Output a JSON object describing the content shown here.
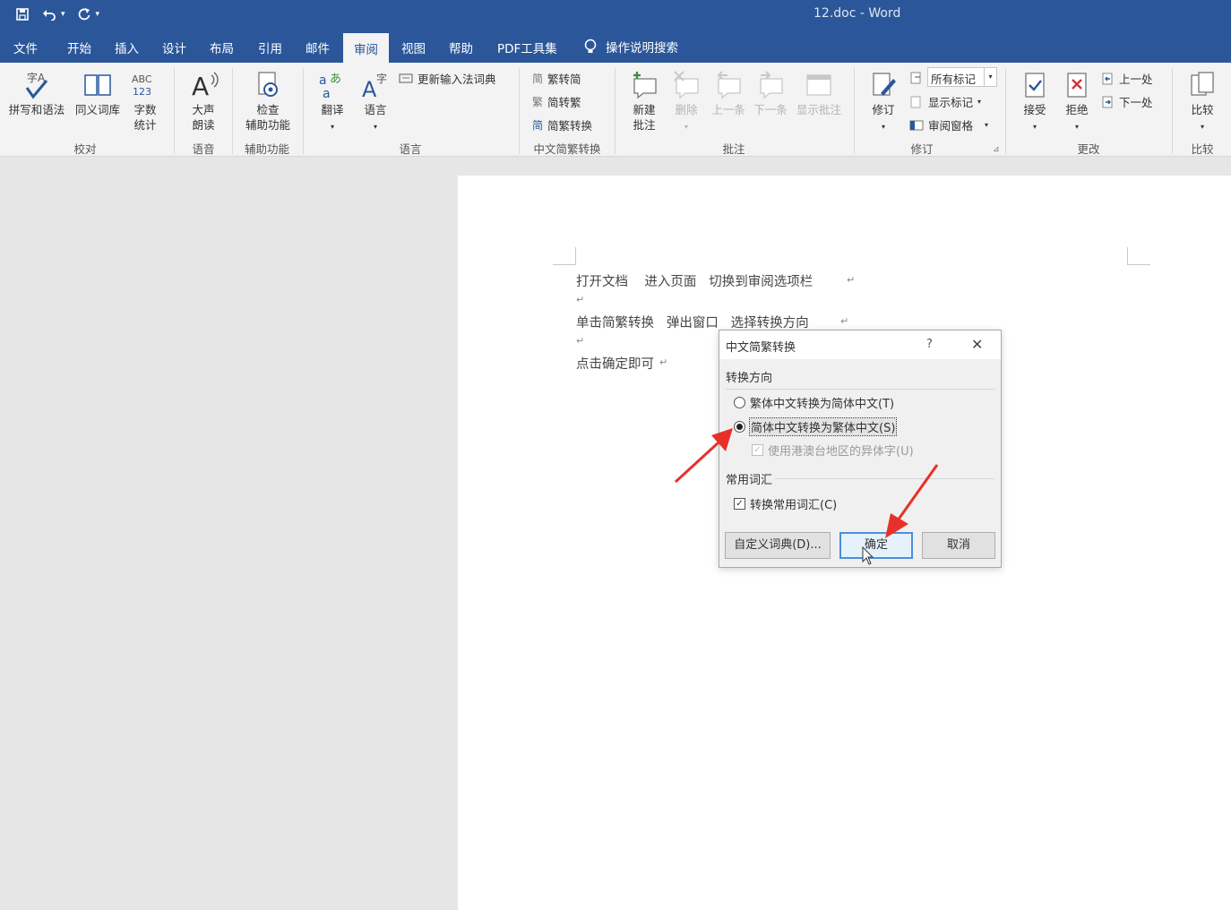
{
  "window": {
    "title": "12.doc  -  Word"
  },
  "tabs": [
    {
      "id": "file",
      "label": "文件",
      "active": false
    },
    {
      "id": "home",
      "label": "开始",
      "active": false
    },
    {
      "id": "insert",
      "label": "插入",
      "active": false
    },
    {
      "id": "design",
      "label": "设计",
      "active": false
    },
    {
      "id": "layout",
      "label": "布局",
      "active": false
    },
    {
      "id": "references",
      "label": "引用",
      "active": false
    },
    {
      "id": "mailings",
      "label": "邮件",
      "active": false
    },
    {
      "id": "review",
      "label": "审阅",
      "active": true
    },
    {
      "id": "view",
      "label": "视图",
      "active": false
    },
    {
      "id": "help",
      "label": "帮助",
      "active": false
    },
    {
      "id": "pdf",
      "label": "PDF工具集",
      "active": false
    }
  ],
  "tell_me": "操作说明搜索",
  "ribbon": {
    "proofing": {
      "group": "校对",
      "spelling": "拼写和语法",
      "thesaurus": "同义词库",
      "wordcount_line1": "字数",
      "wordcount_line2": "统计"
    },
    "speech": {
      "group": "语音",
      "read_line1": "大声",
      "read_line2": "朗读"
    },
    "accessibility": {
      "group": "辅助功能",
      "check_line1": "检查",
      "check_line2": "辅助功能"
    },
    "language": {
      "group": "语言",
      "translate": "翻译",
      "language": "语言",
      "update_ime": "更新输入法词典"
    },
    "chinese_conversion": {
      "group": "中文简繁转换",
      "to_simplified": "繁转简",
      "to_traditional": "简转繁",
      "convert": "简繁转换"
    },
    "comments": {
      "group": "批注",
      "new_line1": "新建",
      "new_line2": "批注",
      "delete": "删除",
      "previous": "上一条",
      "next": "下一条",
      "show": "显示批注"
    },
    "tracking": {
      "group": "修订",
      "track": "修订",
      "markup_dropdown": "所有标记",
      "show_markup": "显示标记",
      "review_pane": "审阅窗格"
    },
    "changes": {
      "group": "更改",
      "accept": "接受",
      "reject": "拒绝",
      "previous": "上一处",
      "next": "下一处"
    },
    "compare": {
      "group": "比较",
      "compare": "比较"
    }
  },
  "document": {
    "line1": "打开文档    进入页面   切换到审阅选项栏",
    "line2": "单击简繁转换   弹出窗口   选择转换方向",
    "line3": "点击确定即可"
  },
  "dialog": {
    "title": "中文简繁转换",
    "help": "?",
    "direction_label": "转换方向",
    "opt_trad_to_simp": "繁体中文转换为简体中文(T)",
    "opt_simp_to_trad": "简体中文转换为繁体中文(S)",
    "opt_hk_variants": "使用港澳台地区的异体字(U)",
    "selected_option": "simp_to_trad",
    "vocab_label": "常用词汇",
    "opt_convert_vocab": "转换常用词汇(C)",
    "convert_vocab_checked": true,
    "btn_custom_dict": "自定义词典(D)...",
    "btn_ok": "确定",
    "btn_cancel": "取消"
  },
  "colors": {
    "title_bar": "#2b579a",
    "ribbon_bg": "#f3f3f3",
    "annotation_arrow": "#e8302a"
  }
}
